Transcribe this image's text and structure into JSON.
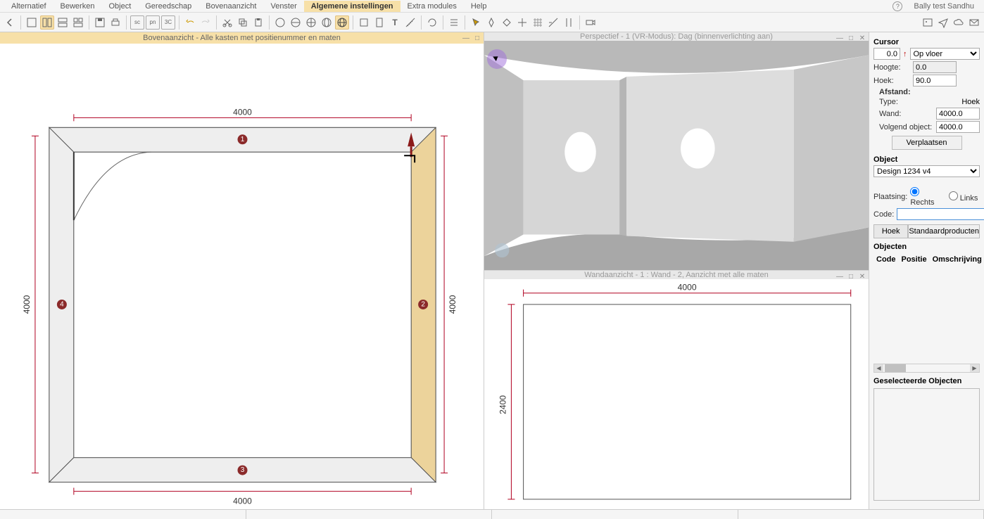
{
  "menu": {
    "items": [
      "Alternatief",
      "Bewerken",
      "Object",
      "Gereedschap",
      "Bovenaanzicht",
      "Venster",
      "Algemene instellingen",
      "Extra modules",
      "Help"
    ],
    "active_index": 6,
    "user": "Bally test  Sandhu"
  },
  "panes": {
    "top": {
      "title": "Bovenaanzicht - Alle kasten met positienummer en maten"
    },
    "persp": {
      "title": "Perspectief - 1 (VR-Modus): Dag (binnenverlichting aan)"
    },
    "wall": {
      "title": "Wandaanzicht - 1 : Wand - 2, Aanzicht met alle maten"
    }
  },
  "plan": {
    "dim_top": "4000",
    "dim_bottom": "4000",
    "dim_left": "4000",
    "dim_right": "4000",
    "walls": [
      "1",
      "2",
      "3",
      "4"
    ]
  },
  "wallview": {
    "dim_top": "4000",
    "dim_left": "2400"
  },
  "sidebar": {
    "cursor_title": "Cursor",
    "cursor_value": "0.0",
    "cursor_mode": "Op vloer",
    "hoogte_label": "Hoogte:",
    "hoogte_value": "0.0",
    "hoek_label": "Hoek:",
    "hoek_value": "90.0",
    "afstand_label": "Afstand:",
    "type_label": "Type:",
    "hoek_col": "Hoek",
    "wand_label": "Wand:",
    "wand_value": "4000.0",
    "volgend_label": "Volgend object:",
    "volgend_value": "4000.0",
    "verplaatsen_btn": "Verplaatsen",
    "object_title": "Object",
    "object_select": "Design 1234 v4",
    "plaatsing_label": "Plaatsing:",
    "radio_rechts": "Rechts",
    "radio_links": "Links",
    "code_label": "Code:",
    "tab_hoek": "Hoek",
    "tab_std": "Standaardproducten",
    "objecten_title": "Objecten",
    "col_code": "Code",
    "col_positie": "Positie",
    "col_omschr": "Omschrijving",
    "sel_title": "Geselecteerde Objecten"
  }
}
